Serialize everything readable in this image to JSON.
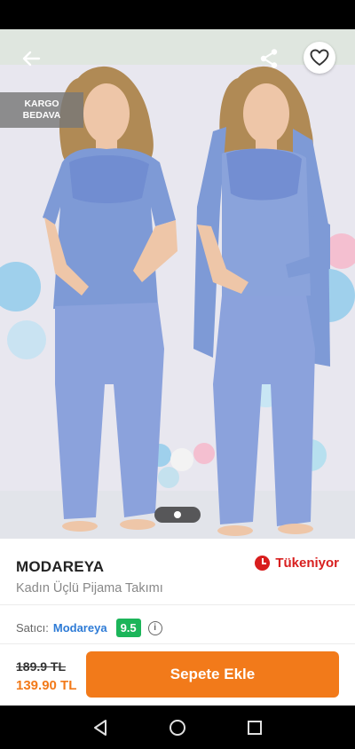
{
  "badges": {
    "kargo_line1": "KARGO",
    "kargo_line2": "BEDAVA"
  },
  "product": {
    "brand": "MODAREYA",
    "name": "Kadın Üçlü Pijama Takımı",
    "stock_status": "Tükeniyor"
  },
  "seller": {
    "label": "Satıcı:",
    "name": "Modareya",
    "score": "9.5"
  },
  "pricing": {
    "old_price": "189.9 TL",
    "new_price": "139.90 TL"
  },
  "actions": {
    "add_to_cart": "Sepete Ekle"
  },
  "gallery": {
    "current_page": 1
  },
  "colors": {
    "accent": "#f27a1a",
    "stock_red": "#d81e1e",
    "score_green": "#1cb55a",
    "seller_link": "#2e7bd6",
    "garment_blue": "#7e9ad6"
  },
  "icons": [
    "back-arrow-icon",
    "share-icon",
    "heart-icon",
    "clock-icon",
    "info-icon",
    "nav-back-icon",
    "nav-home-icon",
    "nav-recents-icon"
  ]
}
